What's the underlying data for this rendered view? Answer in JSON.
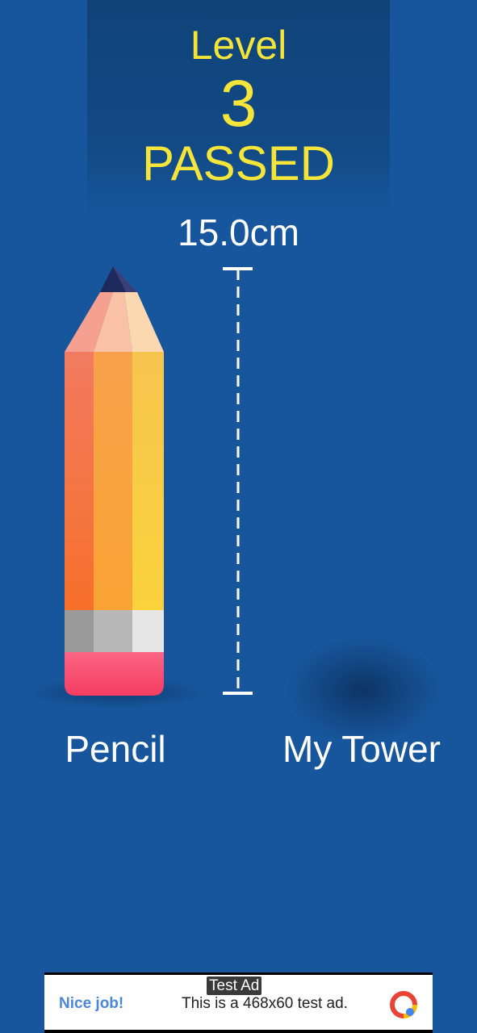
{
  "header": {
    "level_label": "Level",
    "level_number": "3",
    "status": "PASSED"
  },
  "measurement": {
    "height_label": "15.0cm"
  },
  "comparison": {
    "reference_name": "Pencil",
    "player_name": "My Tower"
  },
  "ad": {
    "tag": "Test Ad",
    "cta": "Nice job!",
    "text": "This is a 468x60 test ad.",
    "logo_icon": "ad-network-logo-icon"
  },
  "colors": {
    "background": "#17569c",
    "title_yellow": "#f5e53a",
    "text_white": "#ffffff"
  }
}
